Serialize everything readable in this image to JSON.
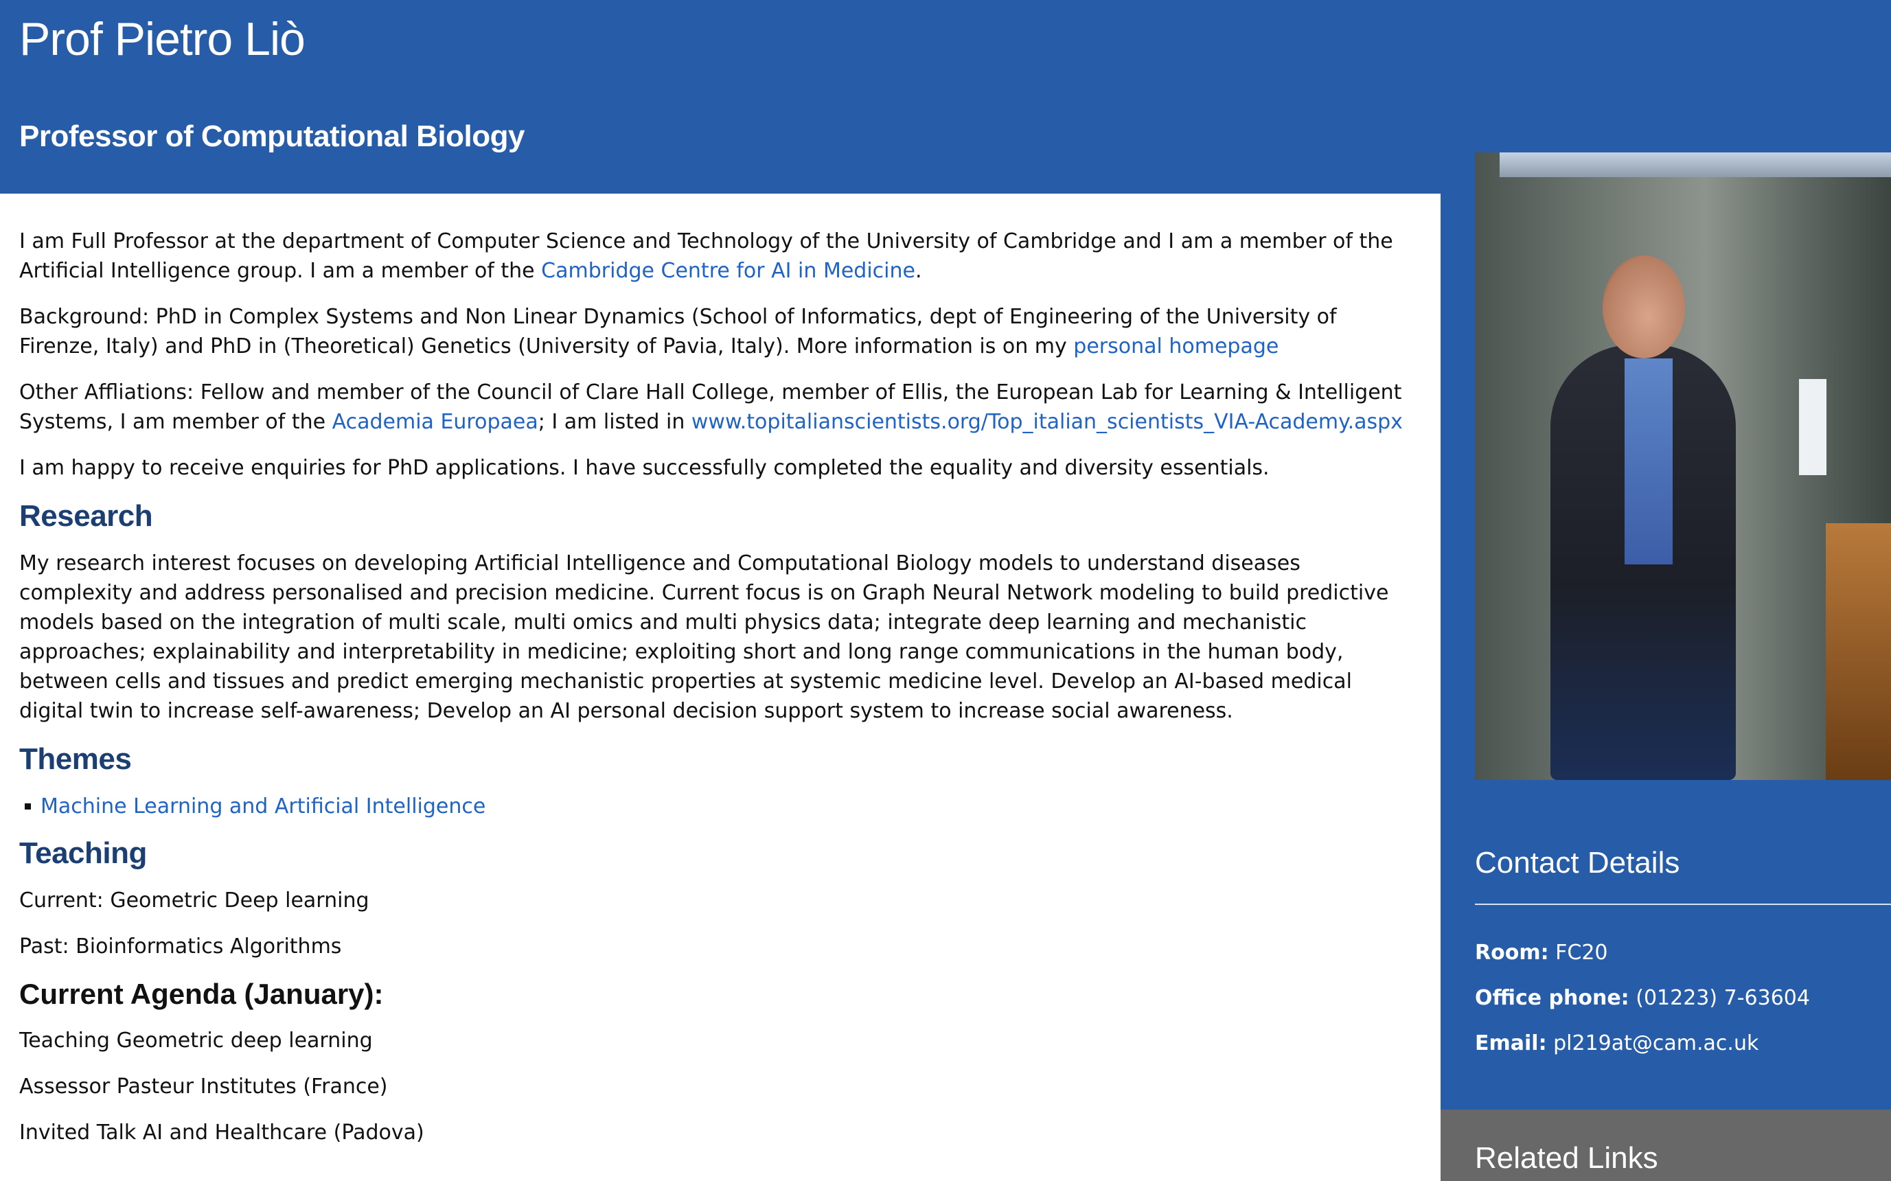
{
  "header": {
    "title": "Prof Pietro Liò",
    "subtitle": "Professor of Computational Biology"
  },
  "intro": {
    "p1_pre": "I am Full Professor at the department of Computer Science and Technology of the University of Cambridge and I am a member of the Artificial Intelligence group. I am a member of the ",
    "p1_link": "Cambridge Centre for AI in Medicine",
    "p1_post": ".",
    "p2_pre": "Background: PhD in Complex Systems and Non Linear Dynamics (School of Informatics, dept of Engineering of the University of Firenze, Italy) and PhD in (Theoretical) Genetics (University of Pavia, Italy). More information is on my ",
    "p2_link": "personal homepage",
    "p3_pre": "Other Affliations: Fellow and member of the Council of Clare Hall College, member of Ellis, the European Lab for Learning & Intelligent Systems, I am member of the ",
    "p3_link1": "Academia Europaea",
    "p3_mid": "; I am listed in ",
    "p3_link2": "www.topitalianscientists.org/Top_italian_scientists_VIA-Academy.aspx",
    "p4": "I am happy to receive enquiries for PhD applications. I have successfully completed the equality and diversity essentials."
  },
  "research": {
    "heading": "Research",
    "text": "My research interest focuses on developing Artificial Intelligence and Computational Biology models to understand diseases complexity and address personalised and precision medicine. Current focus is on Graph Neural Network modeling to build predictive models based on the integration of multi scale, multi omics and multi physics data; integrate deep learning and mechanistic approaches; explainability and interpretability in medicine; exploiting short and long range communications in the human body, between cells and tissues and predict emerging mechanistic properties at systemic medicine level. Develop an AI-based medical digital twin to increase self-awareness; Develop an AI personal decision support system to increase social awareness."
  },
  "themes": {
    "heading": "Themes",
    "items": [
      "Machine Learning and Artificial Intelligence"
    ]
  },
  "teaching": {
    "heading": "Teaching",
    "current": "Current: Geometric Deep learning",
    "past": "Past: Bioinformatics Algorithms"
  },
  "agenda": {
    "heading": "Current Agenda (January):",
    "items": [
      "Teaching Geometric deep learning",
      "Assessor Pasteur Institutes (France)",
      "Invited Talk AI and Healthcare (Padova)"
    ]
  },
  "contact": {
    "heading": "Contact Details",
    "room_label": "Room:",
    "room": "FC20",
    "phone_label": "Office phone:",
    "phone": "(01223) 7-63604",
    "email_label": "Email:",
    "email": "pl219at@cam.ac.uk"
  },
  "related": {
    "heading": "Related Links"
  },
  "colors": {
    "brand_blue": "#265ca8",
    "heading_blue": "#1b3f73",
    "link_blue": "#1f63c4",
    "related_gray": "#686868"
  }
}
